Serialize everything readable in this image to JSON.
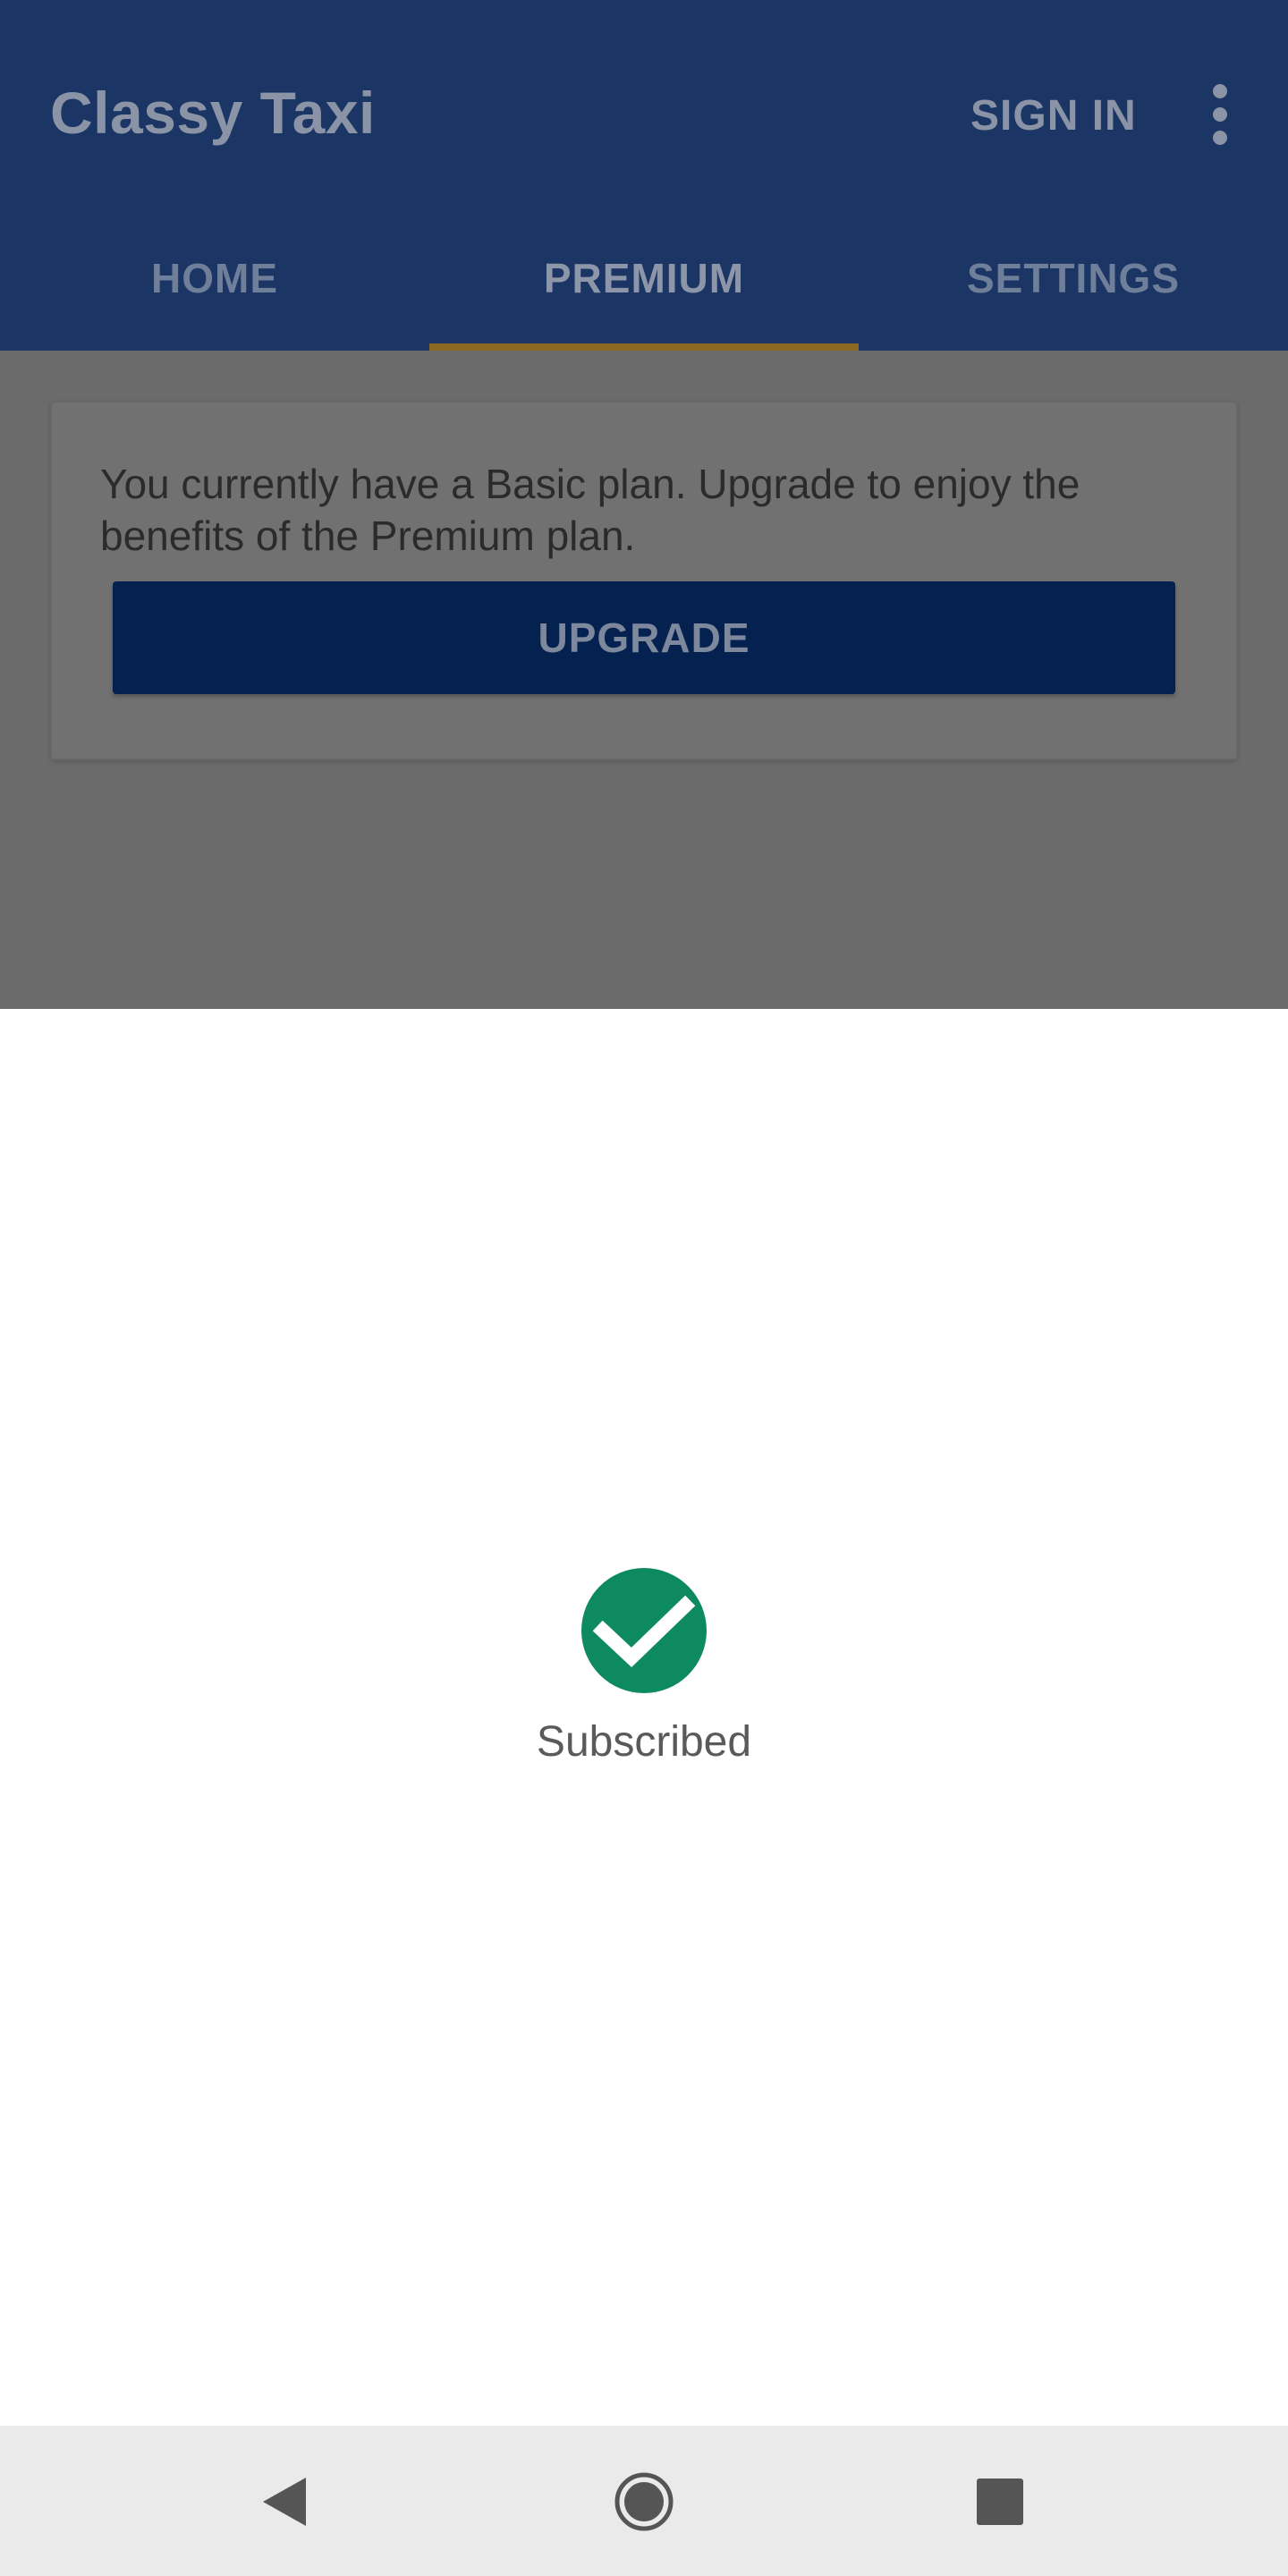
{
  "app": {
    "title": "Classy Taxi",
    "sign_in_label": "SIGN IN",
    "overflow_icon": "more-vert-icon"
  },
  "tabs": [
    {
      "label": "HOME",
      "active": false
    },
    {
      "label": "PREMIUM",
      "active": true
    },
    {
      "label": "SETTINGS",
      "active": false
    }
  ],
  "premium_card": {
    "message": "You currently have a Basic plan. Upgrade to enjoy the benefits of the Premium plan.",
    "upgrade_label": "UPGRADE"
  },
  "sheet": {
    "status_icon": "check-circle-icon",
    "status_text": "Subscribed"
  },
  "navbar": {
    "back_icon": "back-triangle-icon",
    "home_icon": "home-circle-icon",
    "recents_icon": "recents-square-icon"
  },
  "colors": {
    "app_bar": "#1b3565",
    "tab_indicator": "#8a6a22",
    "upgrade_button": "#04214f",
    "success_green": "#0e8a60",
    "scrim": "#6b6b6b"
  }
}
